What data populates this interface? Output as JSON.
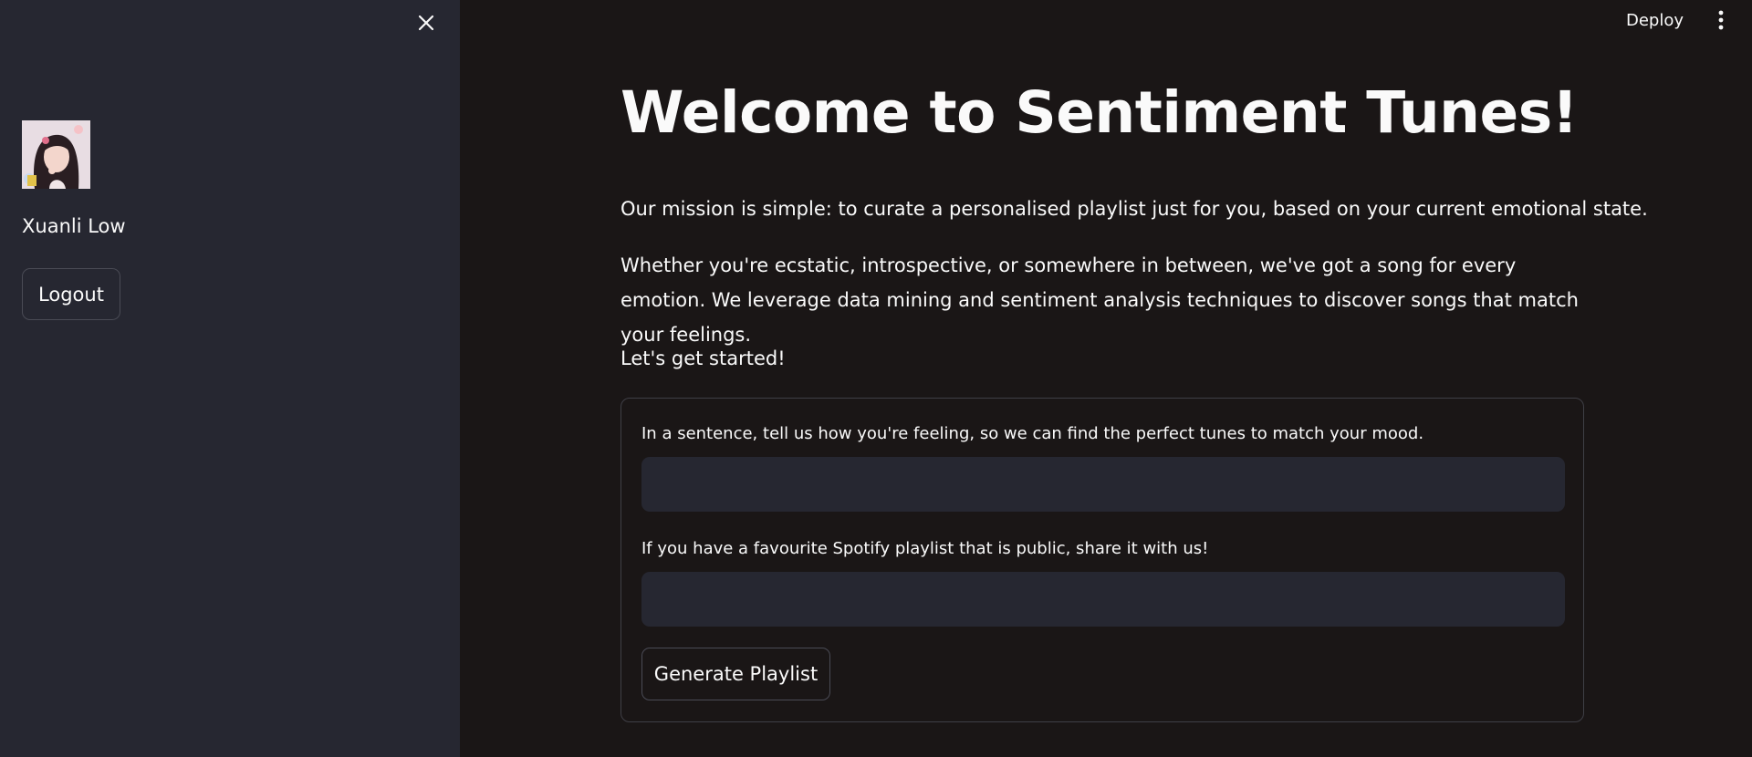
{
  "sidebar": {
    "user_name": "Xuanli Low",
    "logout_label": "Logout",
    "close_icon": "close-icon"
  },
  "header": {
    "deploy_label": "Deploy",
    "menu_icon": "kebab-menu-icon"
  },
  "main": {
    "title": "Welcome to Sentiment Tunes!",
    "paragraphs": [
      "Our mission is simple: to curate a personalised playlist just for you, based on your current emotional state.",
      "Whether you're ecstatic, introspective, or somewhere in between, we've got a song for every emotion. We leverage data mining and sentiment analysis techniques to discover songs that match your feelings.",
      "Let's get started!"
    ],
    "form": {
      "mood_label": "In a sentence, tell us how you're feeling, so we can find the perfect tunes to match your mood.",
      "mood_value": "",
      "playlist_label": "If you have a favourite Spotify playlist that is public, share it with us!",
      "playlist_value": "",
      "submit_label": "Generate Playlist"
    }
  },
  "colors": {
    "background": "#1a1616",
    "sidebar": "#262731",
    "input": "#262731",
    "text": "#fafafa",
    "border": "#3f3f46"
  }
}
